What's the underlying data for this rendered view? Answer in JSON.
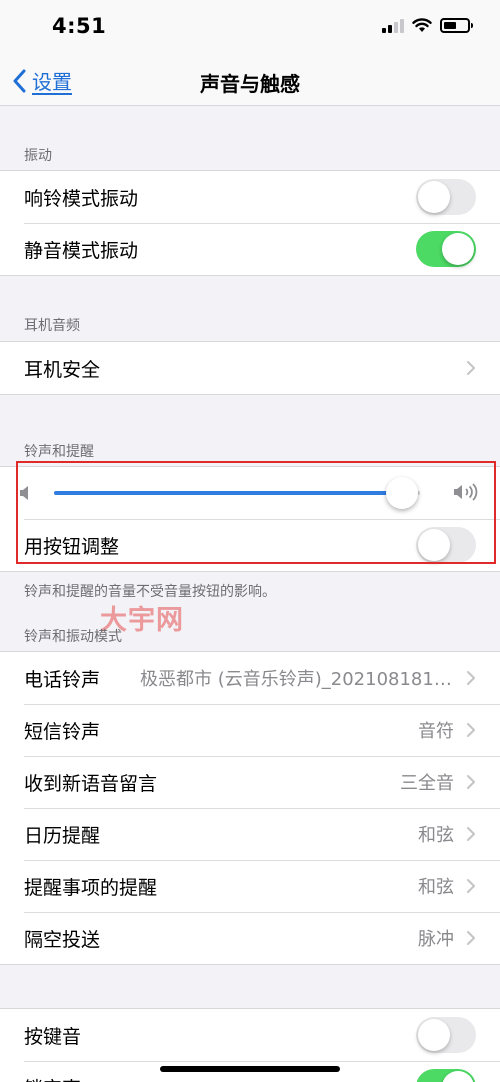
{
  "status_bar": {
    "time": "4:51",
    "signal_bars": 2,
    "battery_level": 0.55
  },
  "nav": {
    "back_label": "设置",
    "title": "声音与触感"
  },
  "vibration": {
    "header": "振动",
    "rows": [
      {
        "label": "响铃模式振动",
        "on": false
      },
      {
        "label": "静音模式振动",
        "on": true
      }
    ]
  },
  "headphone": {
    "header": "耳机音频",
    "rows": [
      {
        "label": "耳机安全"
      }
    ]
  },
  "ringer": {
    "header": "铃声和提醒",
    "volume_level": 0.95,
    "change_with_buttons": {
      "label": "用按钮调整",
      "on": false
    },
    "footer": "铃声和提醒的音量不受音量按钮的影响。"
  },
  "watermark": "大宇网",
  "sounds": {
    "header": "铃声和振动模式",
    "rows": [
      {
        "label": "电话铃声",
        "value": "极恶都市 (云音乐铃声)_20210818105..."
      },
      {
        "label": "短信铃声",
        "value": "音符"
      },
      {
        "label": "收到新语音留言",
        "value": "三全音"
      },
      {
        "label": "日历提醒",
        "value": "和弦"
      },
      {
        "label": "提醒事项的提醒",
        "value": "和弦"
      },
      {
        "label": "隔空投送",
        "value": "脉冲"
      }
    ]
  },
  "keyboard": {
    "rows": [
      {
        "label": "按键音",
        "on": false
      },
      {
        "label": "锁定声",
        "on": true
      }
    ]
  },
  "colors": {
    "accent": "#1f6fd6",
    "toggle_on": "#4cd964",
    "slider_fill": "#2f7de1",
    "highlight": "#e02a2a"
  }
}
